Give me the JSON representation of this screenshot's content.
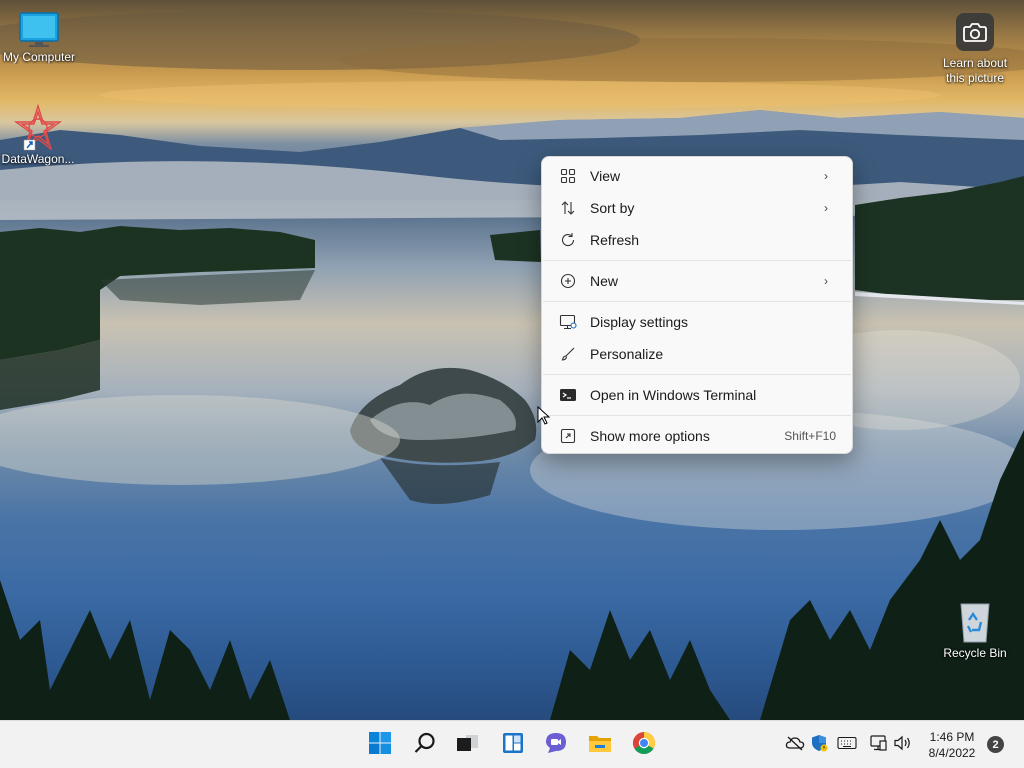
{
  "desktop": {
    "icons": [
      {
        "label": "My Computer",
        "icon": "monitor-icon"
      },
      {
        "label": "DataWagon...",
        "icon": "datawagon-icon"
      },
      {
        "label": "Learn about this picture",
        "icon": "camera-icon"
      },
      {
        "label": "Recycle Bin",
        "icon": "recycle-bin-icon"
      }
    ]
  },
  "context_menu": {
    "items": [
      {
        "label": "View",
        "icon": "grid-icon",
        "submenu": true
      },
      {
        "label": "Sort by",
        "icon": "sort-icon",
        "submenu": true
      },
      {
        "label": "Refresh",
        "icon": "refresh-icon",
        "submenu": false
      },
      {
        "label": "New",
        "icon": "plus-circle-icon",
        "submenu": true
      },
      {
        "label": "Display settings",
        "icon": "display-icon",
        "submenu": false
      },
      {
        "label": "Personalize",
        "icon": "brush-icon",
        "submenu": false
      },
      {
        "label": "Open in Windows Terminal",
        "icon": "terminal-icon",
        "submenu": false
      },
      {
        "label": "Show more options",
        "icon": "expand-icon",
        "submenu": false,
        "shortcut": "Shift+F10"
      }
    ]
  },
  "taskbar": {
    "apps": [
      {
        "name": "Start",
        "icon": "windows-start-icon"
      },
      {
        "name": "Search",
        "icon": "search-icon"
      },
      {
        "name": "Task View",
        "icon": "task-view-icon"
      },
      {
        "name": "Widgets",
        "icon": "widgets-icon"
      },
      {
        "name": "Chat",
        "icon": "chat-icon"
      },
      {
        "name": "File Explorer",
        "icon": "folder-icon"
      },
      {
        "name": "Chrome",
        "icon": "chrome-icon"
      }
    ],
    "tray": {
      "icons": [
        "onedrive-icon",
        "security-icon",
        "keyboard-icon",
        "network-icon",
        "volume-icon"
      ],
      "time": "1:46 PM",
      "date": "8/4/2022",
      "notification_count": "2"
    }
  },
  "colors": {
    "accent": "#0067c0",
    "menu_bg": "#f9f9f9",
    "taskbar_bg": "#f2f2f2"
  }
}
